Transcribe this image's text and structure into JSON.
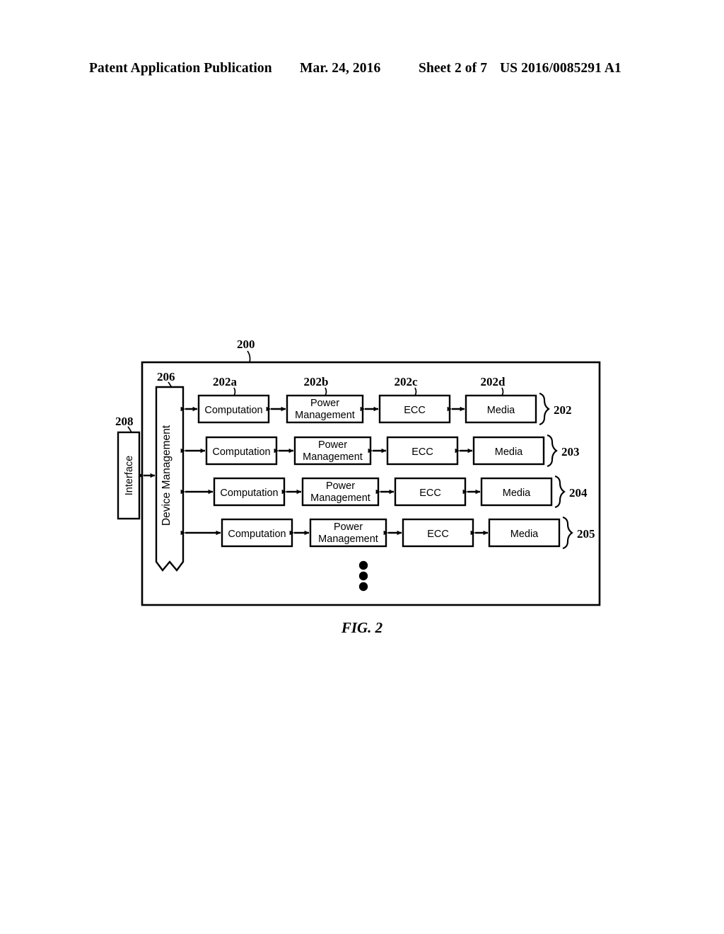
{
  "header": {
    "publication": "Patent Application Publication",
    "date": "Mar. 24, 2016",
    "sheet": "Sheet 2 of 7",
    "patent_number": "US 2016/0085291 A1"
  },
  "figure": {
    "caption": "FIG. 2",
    "outer_ref": "200",
    "device_management_ref": "206",
    "interface_ref": "208",
    "interface_label": "Interface",
    "device_management_label": "Device Management",
    "column_refs": [
      "202a",
      "202b",
      "202c",
      "202d"
    ],
    "row_refs": [
      "202",
      "203",
      "204",
      "205"
    ],
    "stage_labels": {
      "computation": "Computation",
      "power_management_line1": "Power",
      "power_management_line2": "Management",
      "ecc": "ECC",
      "media": "Media"
    },
    "rows": [
      {
        "ref": "202",
        "stages": [
          {
            "name": "computation",
            "lines": [
              "Computation"
            ]
          },
          {
            "name": "power-management",
            "lines": [
              "Power",
              "Management"
            ]
          },
          {
            "name": "ecc",
            "lines": [
              "ECC"
            ]
          },
          {
            "name": "media",
            "lines": [
              "Media"
            ]
          }
        ]
      },
      {
        "ref": "203",
        "stages": [
          {
            "name": "computation",
            "lines": [
              "Computation"
            ]
          },
          {
            "name": "power-management",
            "lines": [
              "Power",
              "Management"
            ]
          },
          {
            "name": "ecc",
            "lines": [
              "ECC"
            ]
          },
          {
            "name": "media",
            "lines": [
              "Media"
            ]
          }
        ]
      },
      {
        "ref": "204",
        "stages": [
          {
            "name": "computation",
            "lines": [
              "Computation"
            ]
          },
          {
            "name": "power-management",
            "lines": [
              "Power",
              "Management"
            ]
          },
          {
            "name": "ecc",
            "lines": [
              "ECC"
            ]
          },
          {
            "name": "media",
            "lines": [
              "Media"
            ]
          }
        ]
      },
      {
        "ref": "205",
        "stages": [
          {
            "name": "computation",
            "lines": [
              "Computation"
            ]
          },
          {
            "name": "power-management",
            "lines": [
              "Power",
              "Management"
            ]
          },
          {
            "name": "ecc",
            "lines": [
              "ECC"
            ]
          },
          {
            "name": "media",
            "lines": [
              "Media"
            ]
          }
        ]
      }
    ],
    "continuation": "vertical-ellipsis",
    "colors": {
      "ink": "#000000",
      "paper": "#ffffff"
    }
  }
}
